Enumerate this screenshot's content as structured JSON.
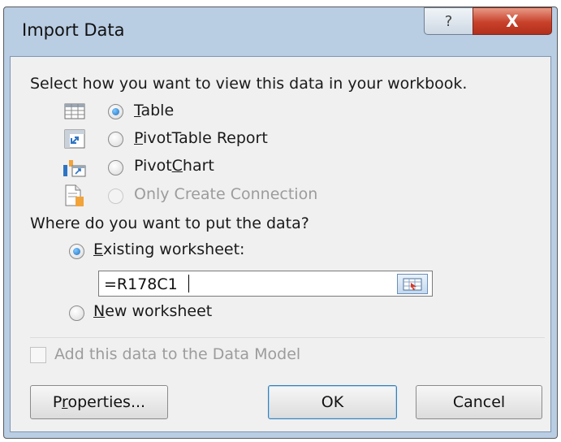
{
  "dialog": {
    "title": "Import Data",
    "help_glyph": "?",
    "close_glyph": "X"
  },
  "view_section": {
    "prompt": "Select how you want to view this data in your workbook.",
    "options": [
      {
        "pre": "",
        "key": "T",
        "post": "able",
        "selected": true,
        "enabled": true,
        "icon": "table-icon"
      },
      {
        "pre": "",
        "key": "P",
        "post": "ivotTable Report",
        "selected": false,
        "enabled": true,
        "icon": "pivottable-icon"
      },
      {
        "pre": "Pivot",
        "key": "C",
        "post": "hart",
        "selected": false,
        "enabled": true,
        "icon": "pivotchart-icon"
      },
      {
        "pre": "Only Create Connection",
        "key": "",
        "post": "",
        "selected": false,
        "enabled": false,
        "icon": "connection-icon"
      }
    ]
  },
  "destination_section": {
    "prompt": "Where do you want to put the data?",
    "existing": {
      "pre": "",
      "key": "E",
      "post": "xisting worksheet:",
      "selected": true
    },
    "cell_reference": "=R178C1",
    "new": {
      "pre": "",
      "key": "N",
      "post": "ew worksheet",
      "selected": false
    }
  },
  "data_model_checkbox": {
    "label": "Add this data to the Data Model",
    "checked": false,
    "enabled": false
  },
  "buttons": {
    "properties": {
      "pre": "P",
      "key": "r",
      "post": "operties..."
    },
    "ok": "OK",
    "cancel": "Cancel"
  },
  "colors": {
    "frame": "#b9cde3",
    "client": "#f0f0f0",
    "close_button": "#c8402a",
    "radio_selected": "#1f6fc0",
    "disabled_text": "#9c9c9c"
  }
}
